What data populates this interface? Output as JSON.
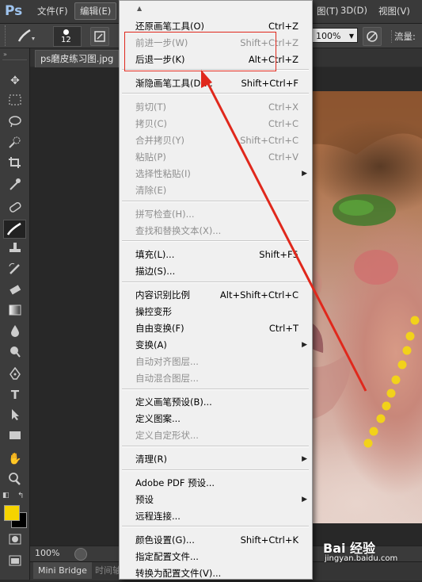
{
  "menubar": {
    "logo": "Ps",
    "items": [
      {
        "label": "文件(F)"
      },
      {
        "label": "编辑(E)"
      },
      {
        "label": "图(T)"
      },
      {
        "label": "3D(D)"
      },
      {
        "label": "视图(V)"
      }
    ]
  },
  "options": {
    "brush_size": "12",
    "zoom_value": "100%",
    "flow_label": "流量:"
  },
  "document": {
    "tab_title": "ps磨皮练习图.jpg",
    "zoom_status": "100%"
  },
  "bottom": {
    "mini_bridge": "Mini Bridge",
    "timeline": "时间轴"
  },
  "edit_menu": {
    "items": [
      {
        "label": "还原画笔工具(O)",
        "shortcut": "Ctrl+Z",
        "disabled": false
      },
      {
        "label": "前进一步(W)",
        "shortcut": "Shift+Ctrl+Z",
        "disabled": true
      },
      {
        "label": "后退一步(K)",
        "shortcut": "Alt+Ctrl+Z",
        "disabled": false
      },
      {
        "label": "渐隐画笔工具(D)...",
        "shortcut": "Shift+Ctrl+F",
        "disabled": false
      },
      {
        "label": "剪切(T)",
        "shortcut": "Ctrl+X",
        "disabled": true
      },
      {
        "label": "拷贝(C)",
        "shortcut": "Ctrl+C",
        "disabled": true
      },
      {
        "label": "合并拷贝(Y)",
        "shortcut": "Shift+Ctrl+C",
        "disabled": true
      },
      {
        "label": "粘贴(P)",
        "shortcut": "Ctrl+V",
        "disabled": true
      },
      {
        "label": "选择性粘贴(I)",
        "shortcut": "",
        "disabled": true,
        "submenu": true
      },
      {
        "label": "清除(E)",
        "shortcut": "",
        "disabled": true
      },
      {
        "label": "拼写检查(H)...",
        "shortcut": "",
        "disabled": true
      },
      {
        "label": "查找和替换文本(X)...",
        "shortcut": "",
        "disabled": true
      },
      {
        "label": "填充(L)...",
        "shortcut": "Shift+F5",
        "disabled": false
      },
      {
        "label": "描边(S)...",
        "shortcut": "",
        "disabled": false
      },
      {
        "label": "内容识别比例",
        "shortcut": "Alt+Shift+Ctrl+C",
        "disabled": false
      },
      {
        "label": "操控变形",
        "shortcut": "",
        "disabled": false
      },
      {
        "label": "自由变换(F)",
        "shortcut": "Ctrl+T",
        "disabled": false
      },
      {
        "label": "变换(A)",
        "shortcut": "",
        "disabled": false,
        "submenu": true
      },
      {
        "label": "自动对齐图层...",
        "shortcut": "",
        "disabled": true
      },
      {
        "label": "自动混合图层...",
        "shortcut": "",
        "disabled": true
      },
      {
        "label": "定义画笔预设(B)...",
        "shortcut": "",
        "disabled": false
      },
      {
        "label": "定义图案...",
        "shortcut": "",
        "disabled": false
      },
      {
        "label": "定义自定形状...",
        "shortcut": "",
        "disabled": true
      },
      {
        "label": "清理(R)",
        "shortcut": "",
        "disabled": false,
        "submenu": true
      },
      {
        "label": "Adobe PDF 预设...",
        "shortcut": "",
        "disabled": false
      },
      {
        "label": "预设",
        "shortcut": "",
        "disabled": false,
        "submenu": true
      },
      {
        "label": "远程连接...",
        "shortcut": "",
        "disabled": false
      },
      {
        "label": "颜色设置(G)...",
        "shortcut": "Shift+Ctrl+K",
        "disabled": false
      },
      {
        "label": "指定配置文件...",
        "shortcut": "",
        "disabled": false
      },
      {
        "label": "转换为配置文件(V)...",
        "shortcut": "",
        "disabled": false
      }
    ]
  },
  "colors": {
    "foreground": "#f5d300",
    "background": "#000000",
    "annotation": "#e0281c",
    "dots": "#f2d21a"
  },
  "watermark": {
    "brand": "Bai 经验",
    "url": "jingyan.baidu.com"
  }
}
